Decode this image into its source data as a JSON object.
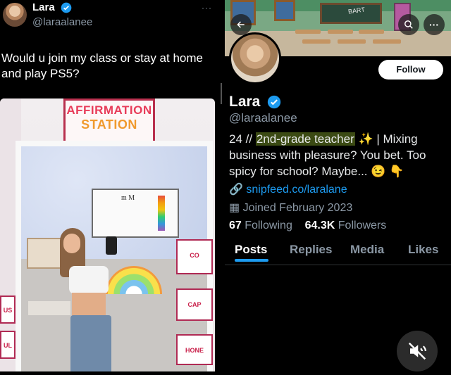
{
  "tweet": {
    "display_name": "Lara",
    "handle": "@laraalanee",
    "more": "···",
    "text": "Would u join my class or stay at home and play PS5?",
    "photo": {
      "sign_line1": "AFFIRMATION",
      "sign_line2": "STATION",
      "whiteboard_text": "m M",
      "side_posters": [
        "CO",
        "CAP",
        "HONE"
      ],
      "left_posters": [
        "US",
        "UL"
      ]
    }
  },
  "profile": {
    "banner_board_text": "BART",
    "back_icon": "arrow-left-icon",
    "search_icon": "search-icon",
    "more_icon": "more-icon",
    "follow_label": "Follow",
    "display_name": "Lara",
    "handle": "@laraalanee",
    "bio_pre": "24 // ",
    "bio_highlight": "2nd-grade teacher",
    "bio_post": " ✨ | Mixing business with pleasure? You bet. Too spicy for school? Maybe... 😉 👇",
    "link": "snipfeed.co/laralane",
    "joined": "Joined February 2023",
    "following_count": "67",
    "following_label": "Following",
    "followers_count": "64.3K",
    "followers_label": "Followers",
    "tabs": [
      "Posts",
      "Replies",
      "Media",
      "Likes"
    ]
  },
  "colors": {
    "accent": "#1d9bf0",
    "background": "#000000",
    "muted_text": "#8b98a5"
  }
}
